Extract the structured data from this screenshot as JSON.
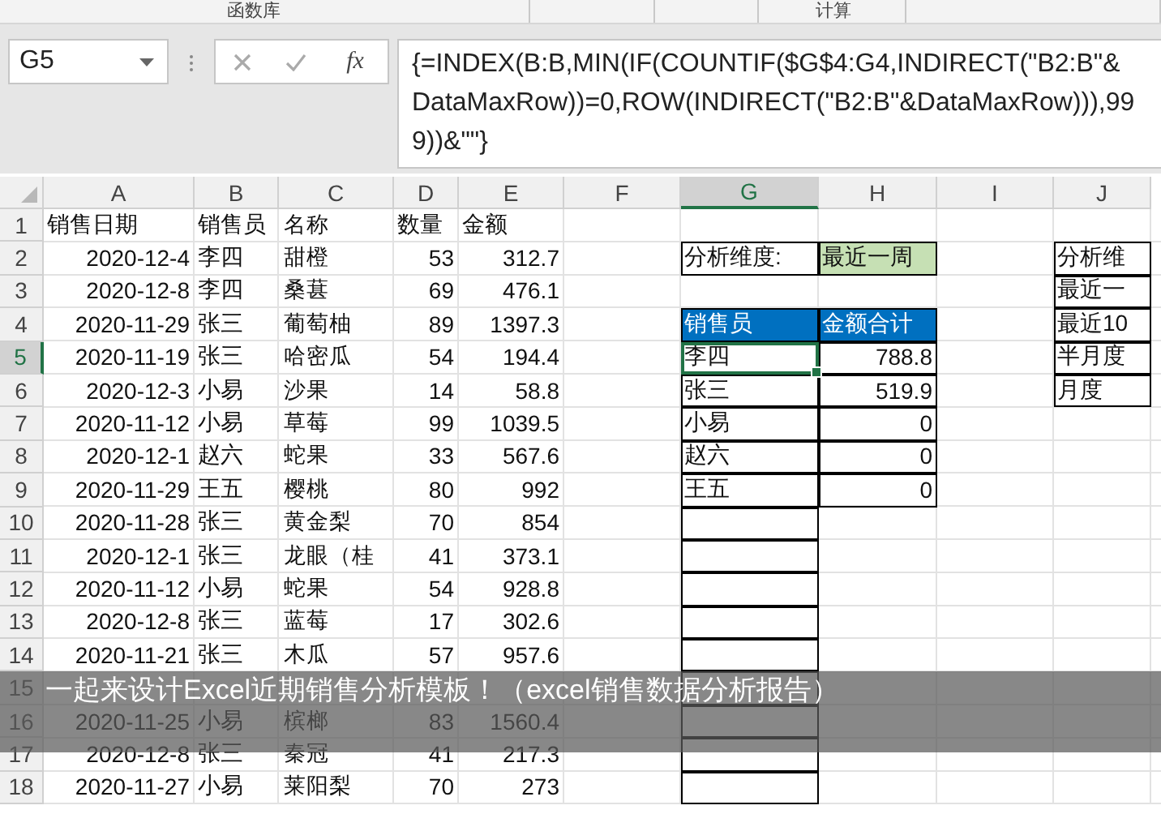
{
  "ribbon": {
    "groups": [
      "函数库",
      "计算"
    ]
  },
  "formula_bar": {
    "name_box": "G5",
    "function_label": "fx",
    "formula": "{=INDEX(B:B,MIN(IF(COUNTIF($G$4:G4,INDIRECT(\"B2:B\"&DataMaxRow))=0,ROW(INDIRECT(\"B2:B\"&DataMaxRow))),999))&\"\"}"
  },
  "columns": [
    {
      "label": "A",
      "selected": false
    },
    {
      "label": "B",
      "selected": false
    },
    {
      "label": "C",
      "selected": false
    },
    {
      "label": "D",
      "selected": false
    },
    {
      "label": "E",
      "selected": false
    },
    {
      "label": "F",
      "selected": false
    },
    {
      "label": "G",
      "selected": true
    },
    {
      "label": "H",
      "selected": false
    },
    {
      "label": "I",
      "selected": false
    },
    {
      "label": "J",
      "selected": false
    }
  ],
  "rows": [
    {
      "number": "1",
      "selected": false,
      "A": {
        "text": "销售日期",
        "kind": "plain"
      },
      "B": {
        "text": "销售员",
        "kind": "plain"
      },
      "C": {
        "text": "名称",
        "kind": "plain"
      },
      "D": {
        "text": "数量",
        "kind": "plain"
      },
      "E": {
        "text": "金额",
        "kind": "plain"
      }
    },
    {
      "number": "2",
      "selected": false,
      "A": {
        "text": "2020-12-4",
        "kind": "figure"
      },
      "B": {
        "text": "李四",
        "kind": "plain"
      },
      "C": {
        "text": "甜橙",
        "kind": "plain"
      },
      "D": {
        "text": "53",
        "kind": "figure"
      },
      "E": {
        "text": "312.7",
        "kind": "figure"
      },
      "G": {
        "text": "分析维度:",
        "kind": "framed"
      },
      "H": {
        "text": "最近一周",
        "kind": "option"
      },
      "J": {
        "text": "分析维",
        "kind": "framed"
      }
    },
    {
      "number": "3",
      "selected": false,
      "A": {
        "text": "2020-12-8",
        "kind": "figure"
      },
      "B": {
        "text": "李四",
        "kind": "plain"
      },
      "C": {
        "text": "桑葚",
        "kind": "plain"
      },
      "D": {
        "text": "69",
        "kind": "figure"
      },
      "E": {
        "text": "476.1",
        "kind": "figure"
      },
      "J": {
        "text": "最近一",
        "kind": "framed"
      }
    },
    {
      "number": "4",
      "selected": false,
      "A": {
        "text": "2020-11-29",
        "kind": "figure"
      },
      "B": {
        "text": "张三",
        "kind": "plain"
      },
      "C": {
        "text": "葡萄柚",
        "kind": "plain"
      },
      "D": {
        "text": "89",
        "kind": "figure"
      },
      "E": {
        "text": "1397.3",
        "kind": "figure"
      },
      "G": {
        "text": "销售员",
        "kind": "heading"
      },
      "H": {
        "text": "金额合计",
        "kind": "heading"
      },
      "J": {
        "text": "最近10",
        "kind": "framed"
      }
    },
    {
      "number": "5",
      "selected": true,
      "A": {
        "text": "2020-11-19",
        "kind": "figure"
      },
      "B": {
        "text": "张三",
        "kind": "plain"
      },
      "C": {
        "text": "哈密瓜",
        "kind": "plain"
      },
      "D": {
        "text": "54",
        "kind": "figure"
      },
      "E": {
        "text": "194.4",
        "kind": "figure"
      },
      "G": {
        "text": "李四",
        "kind": "framed"
      },
      "H": {
        "text": "788.8",
        "kind": "framed_figure"
      },
      "J": {
        "text": "半月度",
        "kind": "framed"
      }
    },
    {
      "number": "6",
      "selected": false,
      "A": {
        "text": "2020-12-3",
        "kind": "figure"
      },
      "B": {
        "text": "小易",
        "kind": "plain"
      },
      "C": {
        "text": "沙果",
        "kind": "plain"
      },
      "D": {
        "text": "14",
        "kind": "figure"
      },
      "E": {
        "text": "58.8",
        "kind": "figure"
      },
      "G": {
        "text": "张三",
        "kind": "framed"
      },
      "H": {
        "text": "519.9",
        "kind": "framed_figure"
      },
      "J": {
        "text": "月度",
        "kind": "framed"
      }
    },
    {
      "number": "7",
      "selected": false,
      "A": {
        "text": "2020-11-12",
        "kind": "figure"
      },
      "B": {
        "text": "小易",
        "kind": "plain"
      },
      "C": {
        "text": "草莓",
        "kind": "plain"
      },
      "D": {
        "text": "99",
        "kind": "figure"
      },
      "E": {
        "text": "1039.5",
        "kind": "figure"
      },
      "G": {
        "text": "小易",
        "kind": "framed"
      },
      "H": {
        "text": "0",
        "kind": "framed_figure"
      }
    },
    {
      "number": "8",
      "selected": false,
      "A": {
        "text": "2020-12-1",
        "kind": "figure"
      },
      "B": {
        "text": "赵六",
        "kind": "plain"
      },
      "C": {
        "text": "蛇果",
        "kind": "plain"
      },
      "D": {
        "text": "33",
        "kind": "figure"
      },
      "E": {
        "text": "567.6",
        "kind": "figure"
      },
      "G": {
        "text": "赵六",
        "kind": "framed"
      },
      "H": {
        "text": "0",
        "kind": "framed_figure"
      }
    },
    {
      "number": "9",
      "selected": false,
      "A": {
        "text": "2020-11-29",
        "kind": "figure"
      },
      "B": {
        "text": "王五",
        "kind": "plain"
      },
      "C": {
        "text": "樱桃",
        "kind": "plain"
      },
      "D": {
        "text": "80",
        "kind": "figure"
      },
      "E": {
        "text": "992",
        "kind": "figure"
      },
      "G": {
        "text": "王五",
        "kind": "framed"
      },
      "H": {
        "text": "0",
        "kind": "framed_figure"
      }
    },
    {
      "number": "10",
      "selected": false,
      "A": {
        "text": "2020-11-28",
        "kind": "figure"
      },
      "B": {
        "text": "张三",
        "kind": "plain"
      },
      "C": {
        "text": "黄金梨",
        "kind": "plain"
      },
      "D": {
        "text": "70",
        "kind": "figure"
      },
      "E": {
        "text": "854",
        "kind": "figure"
      },
      "G": {
        "kind": "frame"
      }
    },
    {
      "number": "11",
      "selected": false,
      "A": {
        "text": "2020-12-1",
        "kind": "figure"
      },
      "B": {
        "text": "张三",
        "kind": "plain"
      },
      "C": {
        "text": "龙眼（桂",
        "kind": "plain"
      },
      "D": {
        "text": "41",
        "kind": "figure"
      },
      "E": {
        "text": "373.1",
        "kind": "figure"
      },
      "G": {
        "kind": "frame"
      }
    },
    {
      "number": "12",
      "selected": false,
      "A": {
        "text": "2020-11-12",
        "kind": "figure"
      },
      "B": {
        "text": "小易",
        "kind": "plain"
      },
      "C": {
        "text": "蛇果",
        "kind": "plain"
      },
      "D": {
        "text": "54",
        "kind": "figure"
      },
      "E": {
        "text": "928.8",
        "kind": "figure"
      },
      "G": {
        "kind": "frame"
      }
    },
    {
      "number": "13",
      "selected": false,
      "A": {
        "text": "2020-12-8",
        "kind": "figure"
      },
      "B": {
        "text": "张三",
        "kind": "plain"
      },
      "C": {
        "text": "蓝莓",
        "kind": "plain"
      },
      "D": {
        "text": "17",
        "kind": "figure"
      },
      "E": {
        "text": "302.6",
        "kind": "figure"
      },
      "G": {
        "kind": "frame"
      }
    },
    {
      "number": "14",
      "selected": false,
      "A": {
        "text": "2020-11-21",
        "kind": "figure"
      },
      "B": {
        "text": "张三",
        "kind": "plain"
      },
      "C": {
        "text": "木瓜",
        "kind": "plain"
      },
      "D": {
        "text": "57",
        "kind": "figure"
      },
      "E": {
        "text": "957.6",
        "kind": "figure"
      },
      "G": {
        "kind": "frame"
      }
    },
    {
      "number": "15",
      "selected": false,
      "G": {
        "kind": "frame"
      }
    },
    {
      "number": "16",
      "selected": false,
      "A": {
        "text": "2020-11-25",
        "kind": "figure"
      },
      "B": {
        "text": "小易",
        "kind": "plain"
      },
      "C": {
        "text": "槟榔",
        "kind": "plain"
      },
      "D": {
        "text": "83",
        "kind": "figure"
      },
      "E": {
        "text": "1560.4",
        "kind": "figure"
      },
      "G": {
        "kind": "frame"
      }
    },
    {
      "number": "17",
      "selected": false,
      "A": {
        "text": "2020-12-8",
        "kind": "figure"
      },
      "B": {
        "text": "张三",
        "kind": "plain"
      },
      "C": {
        "text": "秦冠",
        "kind": "plain"
      },
      "D": {
        "text": "41",
        "kind": "figure"
      },
      "E": {
        "text": "217.3",
        "kind": "figure"
      },
      "G": {
        "kind": "frame"
      }
    },
    {
      "number": "18",
      "selected": false,
      "A": {
        "text": "2020-11-27",
        "kind": "figure"
      },
      "B": {
        "text": "小易",
        "kind": "plain"
      },
      "C": {
        "text": "莱阳梨",
        "kind": "plain"
      },
      "D": {
        "text": "70",
        "kind": "figure"
      },
      "E": {
        "text": "273",
        "kind": "figure"
      },
      "G": {
        "kind": "frame"
      }
    }
  ],
  "caption": "一起来设计Excel近期销售分析模板！（excel销售数据分析报告）"
}
